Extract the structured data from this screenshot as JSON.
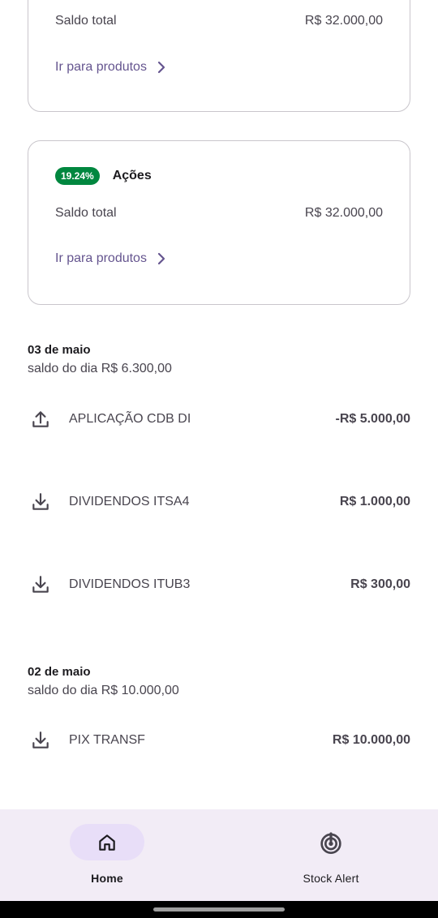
{
  "cards": [
    {
      "balance_label": "Saldo total",
      "balance_value": "R$ 32.000,00",
      "link_label": "Ir para produtos"
    },
    {
      "badge": "19.24%",
      "badge_color": "#00873f",
      "title": "Ações",
      "balance_label": "Saldo total",
      "balance_value": "R$ 32.000,00",
      "link_label": "Ir para produtos"
    }
  ],
  "days": [
    {
      "title": "03 de maio",
      "subtitle": "saldo do dia R$ 6.300,00",
      "transactions": [
        {
          "icon": "upload-icon",
          "label": "APLICAÇÃO CDB DI",
          "amount": "-R$ 5.000,00"
        },
        {
          "icon": "download-icon",
          "label": "DIVIDENDOS ITSA4",
          "amount": "R$ 1.000,00"
        },
        {
          "icon": "download-icon",
          "label": "DIVIDENDOS ITUB3",
          "amount": "R$ 300,00"
        }
      ]
    },
    {
      "title": "02 de maio",
      "subtitle": "saldo do dia R$ 10.000,00",
      "transactions": [
        {
          "icon": "download-icon",
          "label": "PIX TRANSF",
          "amount": "R$ 10.000,00"
        }
      ]
    }
  ],
  "nav": {
    "items": [
      {
        "label": "Home",
        "icon": "home-icon",
        "active": true
      },
      {
        "label": "Stock Alert",
        "icon": "stock-alert-icon",
        "active": false
      }
    ]
  },
  "colors": {
    "accent": "#65558f",
    "nav_background": "#f2ecf6",
    "nav_active_pill": "#e8def8"
  }
}
